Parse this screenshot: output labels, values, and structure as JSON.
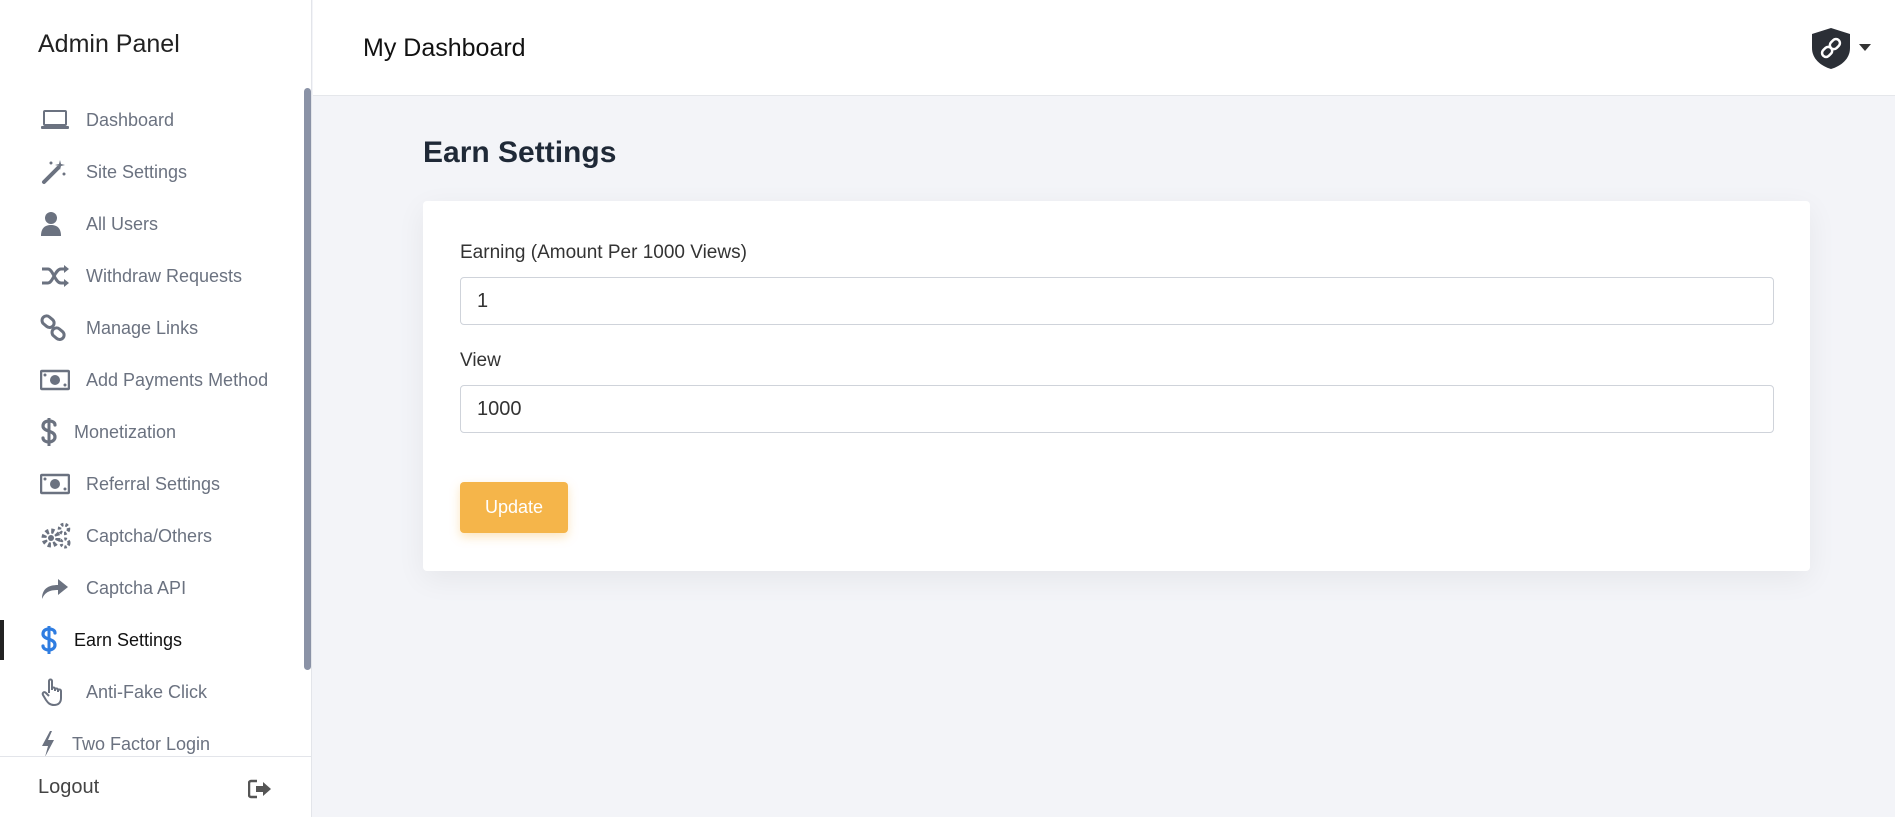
{
  "sidebar": {
    "brand": "Admin Panel",
    "items": [
      {
        "label": "Dashboard",
        "icon": "laptop-icon"
      },
      {
        "label": "Site Settings",
        "icon": "magic-wand-icon"
      },
      {
        "label": "All Users",
        "icon": "user-icon"
      },
      {
        "label": "Withdraw Requests",
        "icon": "shuffle-icon"
      },
      {
        "label": "Manage Links",
        "icon": "link-icon"
      },
      {
        "label": "Add Payments Method",
        "icon": "money-bill-icon"
      },
      {
        "label": "Monetization",
        "icon": "dollar-icon"
      },
      {
        "label": "Referral Settings",
        "icon": "money-bill-icon"
      },
      {
        "label": "Captcha/Others",
        "icon": "gears-icon"
      },
      {
        "label": "Captcha API",
        "icon": "share-arrow-icon"
      },
      {
        "label": "Earn Settings",
        "icon": "dollar-icon",
        "active": true
      },
      {
        "label": "Anti-Fake Click",
        "icon": "hand-pointer-icon"
      },
      {
        "label": "Two Factor Login",
        "icon": "bolt-icon"
      }
    ],
    "logout_label": "Logout",
    "logout_icon": "sign-out-icon"
  },
  "header": {
    "title": "My Dashboard",
    "avatar_icon": "shield-link-icon"
  },
  "main": {
    "page_title": "Earn Settings",
    "form": {
      "earning_label": "Earning (Amount Per 1000 Views)",
      "earning_value": "1",
      "view_label": "View",
      "view_value": "1000",
      "update_label": "Update"
    }
  },
  "colors": {
    "accent": "#f5b54a",
    "active_icon": "#2f7de1",
    "icon_gray": "#6b7280",
    "background": "#f3f4f8"
  }
}
